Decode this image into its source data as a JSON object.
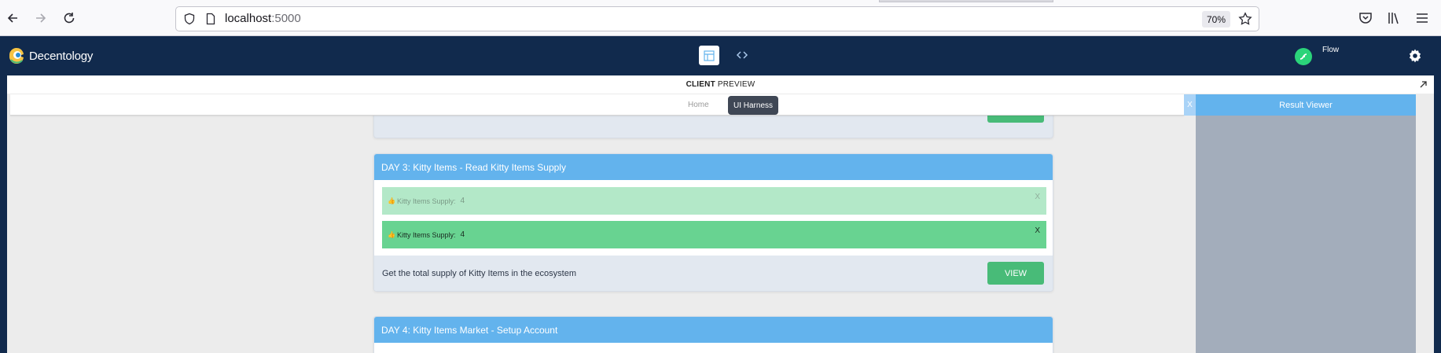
{
  "browser": {
    "url_host": "localhost",
    "url_port": ":5000",
    "zoom": "70%"
  },
  "header": {
    "logo_text": "Decentology",
    "network_label": "Flow"
  },
  "panel": {
    "title_bold": "CLIENT",
    "title_rest": "PREVIEW"
  },
  "nav": {
    "home": "Home",
    "ui_harness": "UI Harness"
  },
  "result_viewer": {
    "close": "X",
    "title": "Result Viewer"
  },
  "cards": [
    {
      "title": "DAY 3: Kitty Items - Read Kitty Items Supply",
      "results": [
        {
          "emoji": "👍",
          "label": "Kitty Items Supply:",
          "value": "4",
          "close": "X"
        },
        {
          "emoji": "👍",
          "label": "Kitty Items Supply:",
          "value": "4",
          "close": "X"
        }
      ],
      "description": "Get the total supply of Kitty Items in the ecosystem",
      "button": "VIEW"
    },
    {
      "title": "DAY 4: Kitty Items Market - Setup Account"
    }
  ],
  "colors": {
    "header_bg": "#112a4d",
    "card_header": "#63b3ed",
    "success": "#48bb78",
    "result_row_active": "#68d391",
    "result_row_faded": "#b3e8c8"
  }
}
